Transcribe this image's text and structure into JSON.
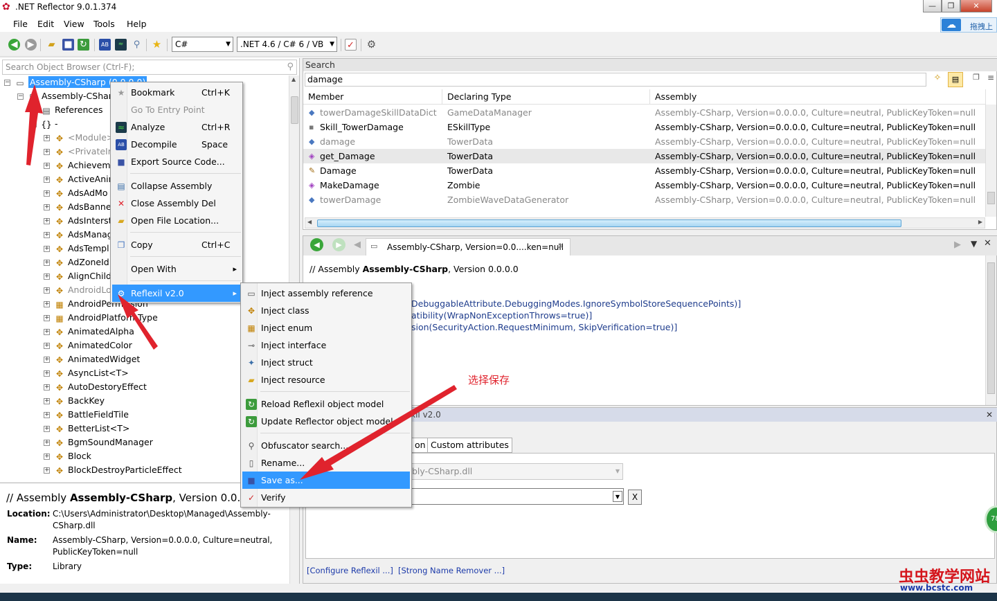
{
  "window": {
    "title": ".NET Reflector 9.0.1.374",
    "buttons": {
      "minimize": "—",
      "maximize": "❐",
      "close": "✕"
    }
  },
  "menu": [
    "File",
    "Edit",
    "View",
    "Tools",
    "Help"
  ],
  "cloud": {
    "label": "拖拽上"
  },
  "toolbar": {
    "language": "C#",
    "framework": ".NET 4.6 / C# 6 / VB"
  },
  "left": {
    "search_placeholder": "Search Object Browser (Ctrl-F);",
    "tree": [
      {
        "label": "Assembly-CSharp (0.0.0.0)",
        "indent": 0,
        "toggle": "⊟",
        "icon": "assembly-icon",
        "selected": true
      },
      {
        "label": "Assembly-CShar",
        "indent": 1,
        "toggle": "⊟",
        "icon": "module-icon"
      },
      {
        "label": "References",
        "indent": 2,
        "toggle": "⊞",
        "icon": "references-icon"
      },
      {
        "label": "-",
        "indent": 2,
        "toggle": "⊟",
        "icon": "namespace-icon"
      },
      {
        "label": "<Module>",
        "indent": 3,
        "toggle": "⊞",
        "icon": "class-icon",
        "gray": true
      },
      {
        "label": "<PrivateIm",
        "indent": 3,
        "toggle": "⊞",
        "icon": "class-icon",
        "gray": true
      },
      {
        "label": "Achieveme",
        "indent": 3,
        "toggle": "⊞",
        "icon": "class-icon"
      },
      {
        "label": "ActiveAnin",
        "indent": 3,
        "toggle": "⊞",
        "icon": "class-icon"
      },
      {
        "label": "AdsAdMo",
        "indent": 3,
        "toggle": "⊞",
        "icon": "class-icon"
      },
      {
        "label": "AdsBanne",
        "indent": 3,
        "toggle": "⊞",
        "icon": "class-icon"
      },
      {
        "label": "AdsInterst",
        "indent": 3,
        "toggle": "⊞",
        "icon": "class-icon"
      },
      {
        "label": "AdsManag",
        "indent": 3,
        "toggle": "⊞",
        "icon": "class-icon"
      },
      {
        "label": "AdsTempl",
        "indent": 3,
        "toggle": "⊞",
        "icon": "class-icon"
      },
      {
        "label": "AdZoneId",
        "indent": 3,
        "toggle": "⊞",
        "icon": "class-icon"
      },
      {
        "label": "AlignChild",
        "indent": 3,
        "toggle": "⊞",
        "icon": "class-icon"
      },
      {
        "label": "AndroidLo",
        "indent": 3,
        "toggle": "⊞",
        "icon": "class-icon",
        "gray": true
      },
      {
        "label": "AndroidPermission",
        "indent": 3,
        "toggle": "⊞",
        "icon": "enum-icon"
      },
      {
        "label": "AndroidPlatformType",
        "indent": 3,
        "toggle": "⊞",
        "icon": "enum-icon"
      },
      {
        "label": "AnimatedAlpha",
        "indent": 3,
        "toggle": "⊞",
        "icon": "class-icon"
      },
      {
        "label": "AnimatedColor",
        "indent": 3,
        "toggle": "⊞",
        "icon": "class-icon"
      },
      {
        "label": "AnimatedWidget",
        "indent": 3,
        "toggle": "⊞",
        "icon": "class-icon"
      },
      {
        "label": "AsyncList<T>",
        "indent": 3,
        "toggle": "⊞",
        "icon": "class-icon"
      },
      {
        "label": "AutoDestoryEffect",
        "indent": 3,
        "toggle": "⊞",
        "icon": "class-icon"
      },
      {
        "label": "BackKey",
        "indent": 3,
        "toggle": "⊞",
        "icon": "class-icon"
      },
      {
        "label": "BattleFieldTile",
        "indent": 3,
        "toggle": "⊞",
        "icon": "class-icon"
      },
      {
        "label": "BetterList<T>",
        "indent": 3,
        "toggle": "⊞",
        "icon": "class-icon"
      },
      {
        "label": "BgmSoundManager",
        "indent": 3,
        "toggle": "⊞",
        "icon": "class-icon"
      },
      {
        "label": "Block",
        "indent": 3,
        "toggle": "⊞",
        "icon": "class-icon"
      },
      {
        "label": "BlockDestroyParticleEffect",
        "indent": 3,
        "toggle": "⊞",
        "icon": "class-icon"
      }
    ],
    "info": {
      "header_prefix": "// Assembly ",
      "header_name": "Assembly-CSharp",
      "header_suffix": ", Version 0.0.0.0",
      "location_label": "Location:",
      "location_line1": "C:\\Users\\Administrator\\Desktop\\Managed\\Assembly-",
      "location_line2": "CSharp.dll",
      "name_label": "Name:",
      "name_line1": "Assembly-CSharp, Version=0.0.0.0, Culture=neutral,",
      "name_line2": "PublicKeyToken=null",
      "type_label": "Type:",
      "type_value": "Library"
    }
  },
  "search": {
    "header": "Search",
    "query": "damage",
    "columns": [
      "Member",
      "Declaring Type",
      "Assembly"
    ],
    "results": [
      {
        "member": "towerDamageSkillDataDict",
        "type": "GameDataManager",
        "assembly": "Assembly-CSharp, Version=0.0.0.0, Culture=neutral, PublicKeyToken=null",
        "gray": true,
        "icon": "field-icon"
      },
      {
        "member": "Skill_TowerDamage",
        "type": "ESkillType",
        "assembly": "Assembly-CSharp, Version=0.0.0.0, Culture=neutral, PublicKeyToken=null",
        "gray": false,
        "icon": "enum-field-icon"
      },
      {
        "member": "damage",
        "type": "TowerData",
        "assembly": "Assembly-CSharp, Version=0.0.0.0, Culture=neutral, PublicKeyToken=null",
        "gray": true,
        "icon": "field-icon"
      },
      {
        "member": "get_Damage",
        "type": "TowerData",
        "assembly": "Assembly-CSharp, Version=0.0.0.0, Culture=neutral, PublicKeyToken=null",
        "gray": false,
        "icon": "method-icon"
      },
      {
        "member": "Damage",
        "type": "TowerData",
        "assembly": "Assembly-CSharp, Version=0.0.0.0, Culture=neutral, PublicKeyToken=null",
        "gray": false,
        "icon": "property-icon"
      },
      {
        "member": "MakeDamage",
        "type": "Zombie",
        "assembly": "Assembly-CSharp, Version=0.0.0.0, Culture=neutral, PublicKeyToken=null",
        "gray": false,
        "icon": "method-icon"
      },
      {
        "member": "towerDamage",
        "type": "ZombieWaveDataGenerator",
        "assembly": "Assembly-CSharp, Version=0.0.0.0, Culture=neutral, PublicKeyToken=null",
        "gray": true,
        "icon": "field-icon"
      }
    ]
  },
  "code": {
    "tab_label": "Assembly-CSharp, Version=0.0....ken=null",
    "header_prefix": "// Assembly ",
    "header_name": "Assembly-CSharp",
    "header_suffix": ", Version 0.0.0.0",
    "line1": "DebuggableAttribute.DebuggingModes.IgnoreSymbolStoreSequencePoints)]",
    "line2": "atibility(WrapNonExceptionThrows=true)]",
    "line3": "sion(SecurityAction.RequestMinimum, SkipVerification=true)]"
  },
  "reflexil": {
    "header": "xil v2.0",
    "tab_partial": "on",
    "tab_custom": "Custom attributes",
    "file_value": "bly-CSharp.dll",
    "x_label": "X",
    "link_configure": "[Configure Reflexil ...]",
    "link_strong": "[Strong Name Remover ...]"
  },
  "context_menu": [
    {
      "label": "Bookmark",
      "shortcut": "Ctrl+K",
      "icon": "star-icon",
      "disabled": false
    },
    {
      "label": "Go To Entry Point",
      "shortcut": "",
      "icon": "",
      "disabled": true
    },
    {
      "label": "Analyze",
      "shortcut": "Ctrl+R",
      "icon": "analyze-icon",
      "disabled": false
    },
    {
      "label": "Decompile",
      "shortcut": "Space",
      "icon": "decompile-icon",
      "disabled": false
    },
    {
      "label": "Export Source Code...",
      "shortcut": "",
      "icon": "save-icon",
      "disabled": false
    },
    {
      "sep": true
    },
    {
      "label": "Collapse Assembly",
      "shortcut": "",
      "icon": "collapse-icon",
      "disabled": false
    },
    {
      "label": "Close Assembly",
      "shortcut": "Del",
      "icon": "close-x-icon",
      "disabled": false
    },
    {
      "label": "Open File Location...",
      "shortcut": "",
      "icon": "folder-icon",
      "disabled": false
    },
    {
      "sep": true
    },
    {
      "label": "Copy",
      "shortcut": "Ctrl+C",
      "icon": "copy-icon",
      "disabled": false
    },
    {
      "sep": true
    },
    {
      "label": "Open With",
      "shortcut": "",
      "icon": "",
      "disabled": false,
      "submenu": true
    },
    {
      "sep": true
    },
    {
      "label": "Reflexil v2.0",
      "shortcut": "",
      "icon": "gear-icon",
      "disabled": false,
      "submenu": true,
      "highlight": true
    }
  ],
  "reflexil_menu": [
    {
      "label": "Inject assembly reference",
      "icon": "reference-icon"
    },
    {
      "label": "Inject class",
      "icon": "class-icon"
    },
    {
      "label": "Inject enum",
      "icon": "enum-icon"
    },
    {
      "label": "Inject interface",
      "icon": "interface-icon"
    },
    {
      "label": "Inject struct",
      "icon": "struct-icon"
    },
    {
      "label": "Inject resource",
      "icon": "folder-icon"
    },
    {
      "sep": true
    },
    {
      "label": "Reload Reflexil object model",
      "icon": "reload-icon"
    },
    {
      "label": "Update Reflector object model",
      "icon": "update-icon"
    },
    {
      "sep": true
    },
    {
      "label": "Obfuscator search...",
      "icon": "search-icon"
    },
    {
      "label": "Rename...",
      "icon": "rename-icon"
    },
    {
      "label": "Save as...",
      "icon": "save-icon",
      "highlight": true
    },
    {
      "label": "Verify",
      "icon": "verify-icon"
    }
  ],
  "annotation": {
    "text": "选择保存"
  },
  "watermark": {
    "text": "虫虫教学网站",
    "subtext": "www.bcstc.com",
    "badge": "78"
  },
  "colors": {
    "highlight": "#3399ff",
    "selection": "#3399ff",
    "arrow": "#e0232d"
  }
}
